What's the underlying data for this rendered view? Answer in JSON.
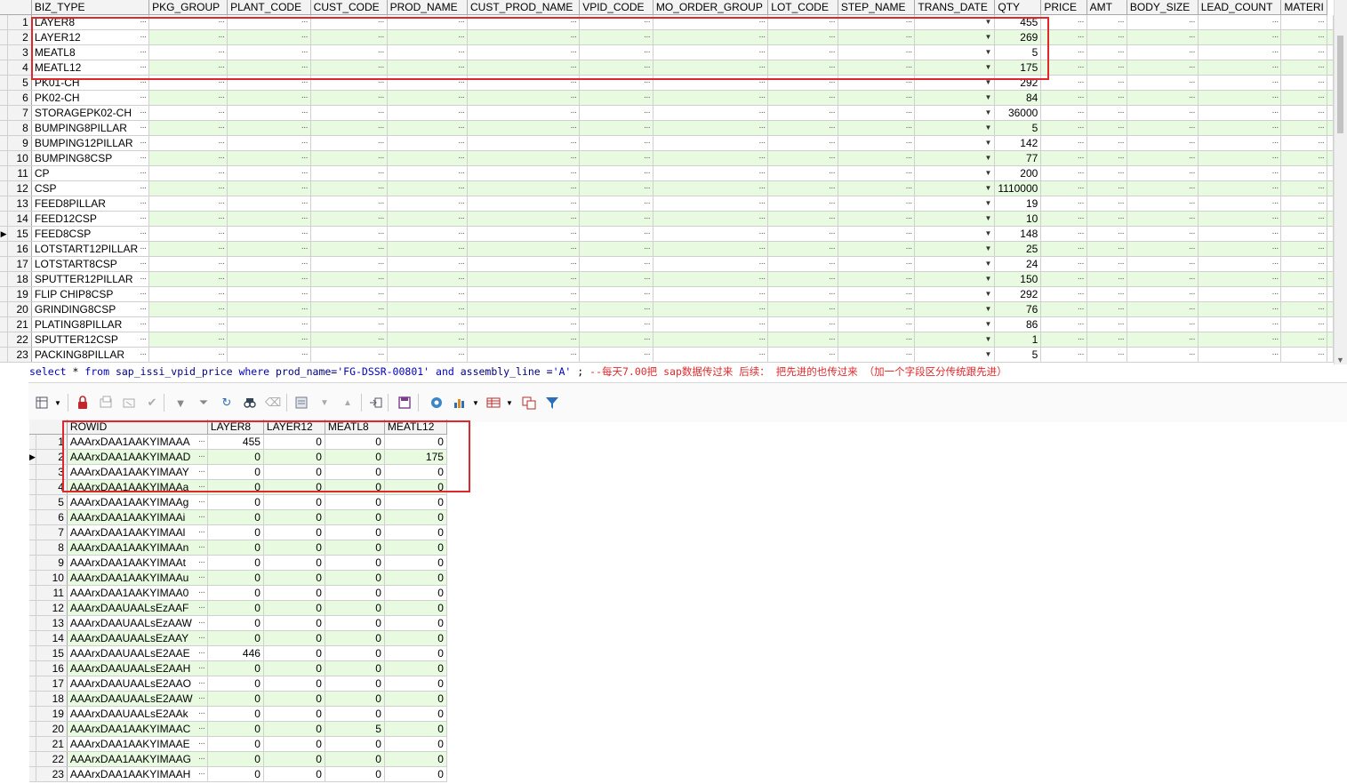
{
  "top_grid": {
    "columns": [
      "BIZ_TYPE",
      "PKG_GROUP",
      "PLANT_CODE",
      "CUST_CODE",
      "PROD_NAME",
      "CUST_PROD_NAME",
      "VPID_CODE",
      "MO_ORDER_GROUP",
      "LOT_CODE",
      "STEP_NAME",
      "TRANS_DATE",
      "QTY",
      "PRICE",
      "AMT",
      "BODY_SIZE",
      "LEAD_COUNT",
      "MATERI"
    ],
    "current_row_indicator": "▶",
    "rows": [
      {
        "n": "1",
        "biz": "LAYER8",
        "qty": "455"
      },
      {
        "n": "2",
        "biz": "LAYER12",
        "qty": "269"
      },
      {
        "n": "3",
        "biz": "MEATL8",
        "qty": "5"
      },
      {
        "n": "4",
        "biz": "MEATL12",
        "qty": "175"
      },
      {
        "n": "5",
        "biz": "PK01-CH",
        "qty": "292"
      },
      {
        "n": "6",
        "biz": "PK02-CH",
        "qty": "84"
      },
      {
        "n": "7",
        "biz": "STORAGEPK02-CH",
        "qty": "36000"
      },
      {
        "n": "8",
        "biz": "BUMPING8PILLAR",
        "qty": "5"
      },
      {
        "n": "9",
        "biz": "BUMPING12PILLAR",
        "qty": "142"
      },
      {
        "n": "10",
        "biz": "BUMPING8CSP",
        "qty": "77"
      },
      {
        "n": "11",
        "biz": "CP",
        "qty": "200"
      },
      {
        "n": "12",
        "biz": "CSP",
        "qty": "1110000"
      },
      {
        "n": "13",
        "biz": "FEED8PILLAR",
        "qty": "19"
      },
      {
        "n": "14",
        "biz": "FEED12CSP",
        "qty": "10"
      },
      {
        "n": "15",
        "biz": "FEED8CSP",
        "qty": "148"
      },
      {
        "n": "16",
        "biz": "LOTSTART12PILLAR",
        "qty": "25"
      },
      {
        "n": "17",
        "biz": "LOTSTART8CSP",
        "qty": "24"
      },
      {
        "n": "18",
        "biz": "SPUTTER12PILLAR",
        "qty": "150"
      },
      {
        "n": "19",
        "biz": "FLIP CHIP8CSP",
        "qty": "292"
      },
      {
        "n": "20",
        "biz": "GRINDING8CSP",
        "qty": "76"
      },
      {
        "n": "21",
        "biz": "PLATING8PILLAR",
        "qty": "86"
      },
      {
        "n": "22",
        "biz": "SPUTTER12CSP",
        "qty": "1"
      },
      {
        "n": "23",
        "biz": "PACKING8PILLAR",
        "qty": "5"
      }
    ]
  },
  "sql": {
    "select": "select",
    "star": " * ",
    "from": "from",
    "table": "  sap_issi_vpid_price ",
    "where": "where",
    "col1": "  prod_name=",
    "str1": "'FG-DSSR-00801'",
    "and": " and",
    "col2": "  assembly_line =",
    "str2": "'A'",
    "semi": "  ;  ",
    "comment": "--每天7.00把 sap数据传过来   后续： 把先进的也传过来  （加一个字段区分传统跟先进）"
  },
  "bottom_grid": {
    "columns": [
      "ROWID",
      "LAYER8",
      "LAYER12",
      "MEATL8",
      "MEATL12"
    ],
    "current_row": "2",
    "rows": [
      {
        "n": "1",
        "rowid": "AAArxDAA1AAKYIMAAA",
        "l8": "455",
        "l12": "0",
        "m8": "0",
        "m12": "0"
      },
      {
        "n": "2",
        "rowid": "AAArxDAA1AAKYIMAAD",
        "l8": "0",
        "l12": "0",
        "m8": "0",
        "m12": "175"
      },
      {
        "n": "3",
        "rowid": "AAArxDAA1AAKYIMAAY",
        "l8": "0",
        "l12": "0",
        "m8": "0",
        "m12": "0"
      },
      {
        "n": "4",
        "rowid": "AAArxDAA1AAKYIMAAa",
        "l8": "0",
        "l12": "0",
        "m8": "0",
        "m12": "0"
      },
      {
        "n": "5",
        "rowid": "AAArxDAA1AAKYIMAAg",
        "l8": "0",
        "l12": "0",
        "m8": "0",
        "m12": "0"
      },
      {
        "n": "6",
        "rowid": "AAArxDAA1AAKYIMAAi",
        "l8": "0",
        "l12": "0",
        "m8": "0",
        "m12": "0"
      },
      {
        "n": "7",
        "rowid": "AAArxDAA1AAKYIMAAl",
        "l8": "0",
        "l12": "0",
        "m8": "0",
        "m12": "0"
      },
      {
        "n": "8",
        "rowid": "AAArxDAA1AAKYIMAAn",
        "l8": "0",
        "l12": "0",
        "m8": "0",
        "m12": "0"
      },
      {
        "n": "9",
        "rowid": "AAArxDAA1AAKYIMAAt",
        "l8": "0",
        "l12": "0",
        "m8": "0",
        "m12": "0"
      },
      {
        "n": "10",
        "rowid": "AAArxDAA1AAKYIMAAu",
        "l8": "0",
        "l12": "0",
        "m8": "0",
        "m12": "0"
      },
      {
        "n": "11",
        "rowid": "AAArxDAA1AAKYIMAA0",
        "l8": "0",
        "l12": "0",
        "m8": "0",
        "m12": "0"
      },
      {
        "n": "12",
        "rowid": "AAArxDAAUAALsEzAAF",
        "l8": "0",
        "l12": "0",
        "m8": "0",
        "m12": "0"
      },
      {
        "n": "13",
        "rowid": "AAArxDAAUAALsEzAAW",
        "l8": "0",
        "l12": "0",
        "m8": "0",
        "m12": "0"
      },
      {
        "n": "14",
        "rowid": "AAArxDAAUAALsEzAAY",
        "l8": "0",
        "l12": "0",
        "m8": "0",
        "m12": "0"
      },
      {
        "n": "15",
        "rowid": "AAArxDAAUAALsE2AAE",
        "l8": "446",
        "l12": "0",
        "m8": "0",
        "m12": "0"
      },
      {
        "n": "16",
        "rowid": "AAArxDAAUAALsE2AAH",
        "l8": "0",
        "l12": "0",
        "m8": "0",
        "m12": "0"
      },
      {
        "n": "17",
        "rowid": "AAArxDAAUAALsE2AAO",
        "l8": "0",
        "l12": "0",
        "m8": "0",
        "m12": "0"
      },
      {
        "n": "18",
        "rowid": "AAArxDAAUAALsE2AAW",
        "l8": "0",
        "l12": "0",
        "m8": "0",
        "m12": "0"
      },
      {
        "n": "19",
        "rowid": "AAArxDAAUAALsE2AAk",
        "l8": "0",
        "l12": "0",
        "m8": "0",
        "m12": "0"
      },
      {
        "n": "20",
        "rowid": "AAArxDAA1AAKYIMAAC",
        "l8": "0",
        "l12": "0",
        "m8": "5",
        "m12": "0"
      },
      {
        "n": "21",
        "rowid": "AAArxDAA1AAKYIMAAE",
        "l8": "0",
        "l12": "0",
        "m8": "0",
        "m12": "0"
      },
      {
        "n": "22",
        "rowid": "AAArxDAA1AAKYIMAAG",
        "l8": "0",
        "l12": "0",
        "m8": "0",
        "m12": "0"
      },
      {
        "n": "23",
        "rowid": "AAArxDAA1AAKYIMAAH",
        "l8": "0",
        "l12": "0",
        "m8": "0",
        "m12": "0"
      }
    ]
  },
  "toolbar_icons": [
    "grid-options-icon",
    "lock-icon",
    "insert-record-icon",
    "delete-record-icon",
    "post-changes-icon",
    "fetch-next-icon",
    "fetch-last-icon",
    "refresh-icon",
    "query-by-example-icon",
    "clear-icon",
    "single-record-view-icon",
    "previous-icon",
    "next-icon",
    "export-icon",
    "save-icon",
    "link-icon",
    "chart-icon",
    "table-view-icon",
    "compare-icon",
    "filter-icon"
  ],
  "colors": {
    "highlight": "#e0282c",
    "row_even": "#e8fbe0",
    "header": "#f3f3f3"
  }
}
